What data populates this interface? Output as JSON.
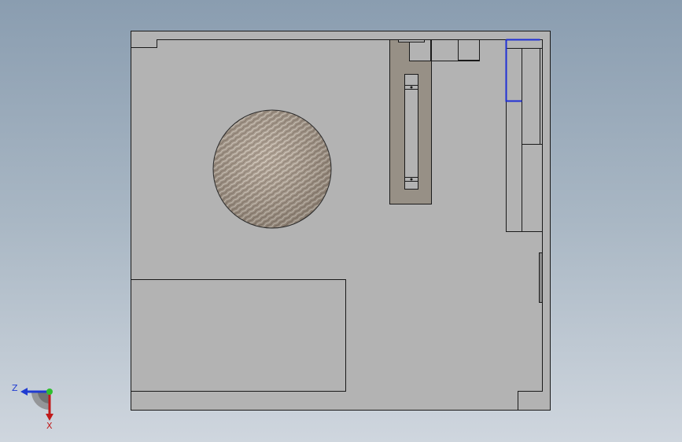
{
  "viewport": {
    "background_top": "#8a9db0",
    "background_bottom": "#cfd6de"
  },
  "model": {
    "body_color": "#b3b3b3",
    "edge_color": "#1a1a1a",
    "slot_color": "#979086",
    "selected_edge_color": "#1f2fd6",
    "disk_texture": "wood-grain"
  },
  "triad": {
    "z_label": "Z",
    "x_label": "X",
    "z_color": "#1f3bd1",
    "x_color": "#c01a1a",
    "y_color": "#2fbf2f"
  }
}
